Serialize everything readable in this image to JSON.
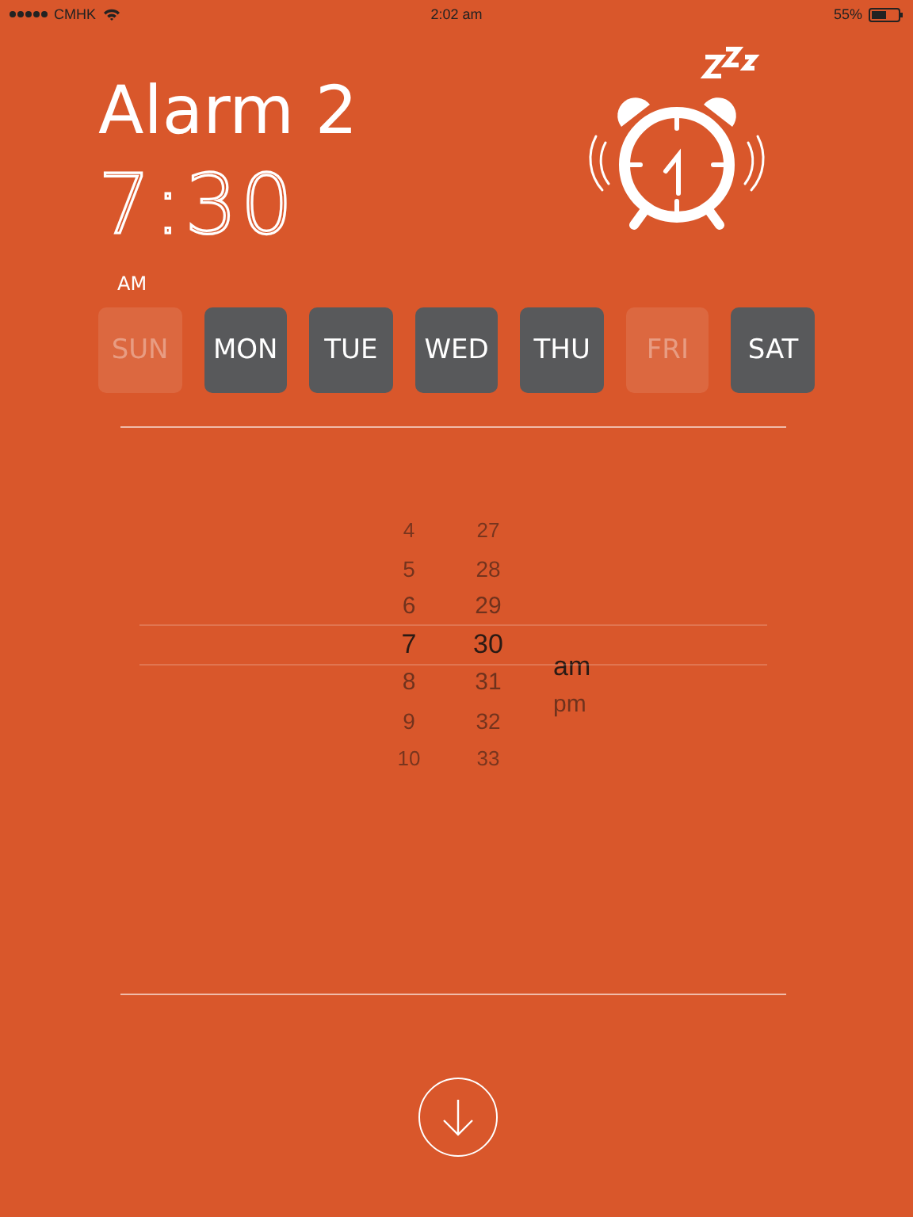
{
  "status_bar": {
    "carrier": "CMHK",
    "time": "2:02 am",
    "battery": "55%"
  },
  "alarm": {
    "title": "Alarm 2",
    "time": "7:30",
    "period": "AM"
  },
  "days": [
    {
      "label": "SUN",
      "selected": false
    },
    {
      "label": "MON",
      "selected": true
    },
    {
      "label": "TUE",
      "selected": true
    },
    {
      "label": "WED",
      "selected": true
    },
    {
      "label": "THU",
      "selected": true
    },
    {
      "label": "FRI",
      "selected": false
    },
    {
      "label": "SAT",
      "selected": true
    }
  ],
  "picker": {
    "columns": [
      {
        "kind": "number",
        "items": [
          {
            "label": "4",
            "selected": false
          },
          {
            "label": "5",
            "selected": false
          },
          {
            "label": "6",
            "selected": false
          },
          {
            "label": "7",
            "selected": true
          },
          {
            "label": "8",
            "selected": false
          },
          {
            "label": "9",
            "selected": false
          },
          {
            "label": "10",
            "selected": false
          }
        ]
      },
      {
        "kind": "number",
        "items": [
          {
            "label": "27",
            "selected": false
          },
          {
            "label": "28",
            "selected": false
          },
          {
            "label": "29",
            "selected": false
          },
          {
            "label": "30",
            "selected": true
          },
          {
            "label": "31",
            "selected": false
          },
          {
            "label": "32",
            "selected": false
          },
          {
            "label": "33",
            "selected": false
          }
        ]
      },
      {
        "kind": "period",
        "items": [
          {
            "label": "am",
            "selected": true
          },
          {
            "label": "pm",
            "selected": false
          }
        ]
      }
    ]
  }
}
